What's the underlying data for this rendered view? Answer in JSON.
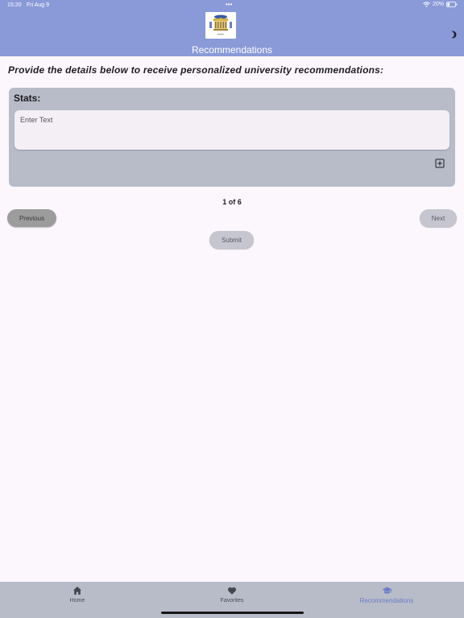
{
  "status_bar": {
    "time": "15:20",
    "date": "Fri Aug 9",
    "dots": "•••",
    "battery": "20%"
  },
  "header": {
    "title": "Recommendations"
  },
  "form": {
    "instructions": "Provide the details below to receive personalized university recommendations:",
    "section_title": "Stats:",
    "input_placeholder": "Enter Text",
    "page_indicator": "1 of 6",
    "previous_label": "Previous",
    "next_label": "Next",
    "submit_label": "Submit"
  },
  "nav": {
    "items": [
      {
        "label": "Home",
        "icon": "home-icon"
      },
      {
        "label": "Favorites",
        "icon": "heart-icon"
      },
      {
        "label": "Recommendations",
        "icon": "graduation-cap-icon",
        "active": true
      }
    ]
  },
  "colors": {
    "header": "#8a9ad8",
    "background": "#fcf7fd",
    "card": "#b8bbc8",
    "accent": "#6d7cc8"
  }
}
